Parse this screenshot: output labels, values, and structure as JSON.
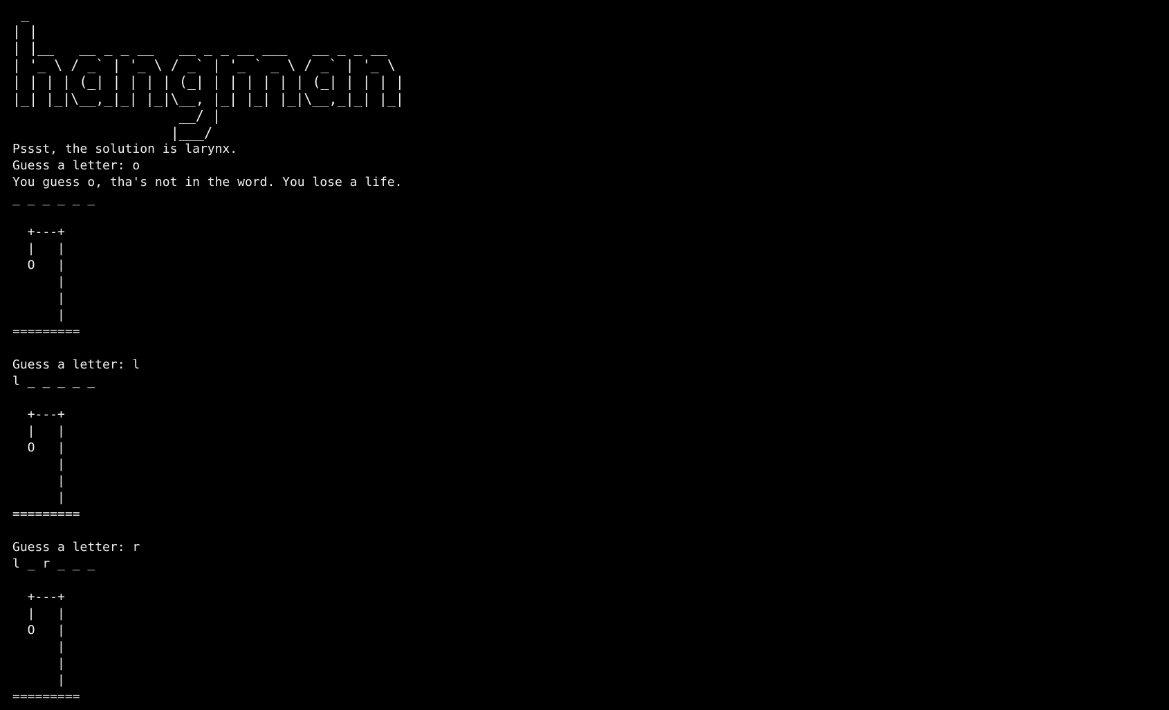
{
  "terminal": {
    "banner": [
      " _",
      "| |",
      "| |__   __ _ _ __   __ _ _ __ ___   __ _ _ __",
      "| '_ \\ / _` | '_ \\ / _` | '_ ` _ \\ / _` | '_ \\",
      "| | | | (_| | | | | (_| | | | | | | (_| | | | |",
      "|_| |_|\\__,_|_| |_|\\__, |_| |_| |_|\\__,_|_| |_|",
      "                    __/ |",
      "                   |___/"
    ],
    "solution_line": "Pssst, the solution is larynx.",
    "rounds": [
      {
        "prompt": "Guess a letter: o",
        "feedback": "You guess o, tha's not in the word. You lose a life.",
        "progress": "_ _ _ _ _ _"
      },
      {
        "prompt": "Guess a letter: l",
        "feedback": "",
        "progress": "l _ _ _ _ _"
      },
      {
        "prompt": "Guess a letter: r",
        "feedback": "",
        "progress": "l _ r _ _ _"
      }
    ],
    "gallows": [
      "  +---+",
      "  |   |",
      "  O   |",
      "      |",
      "      |",
      "      |",
      "========="
    ]
  }
}
